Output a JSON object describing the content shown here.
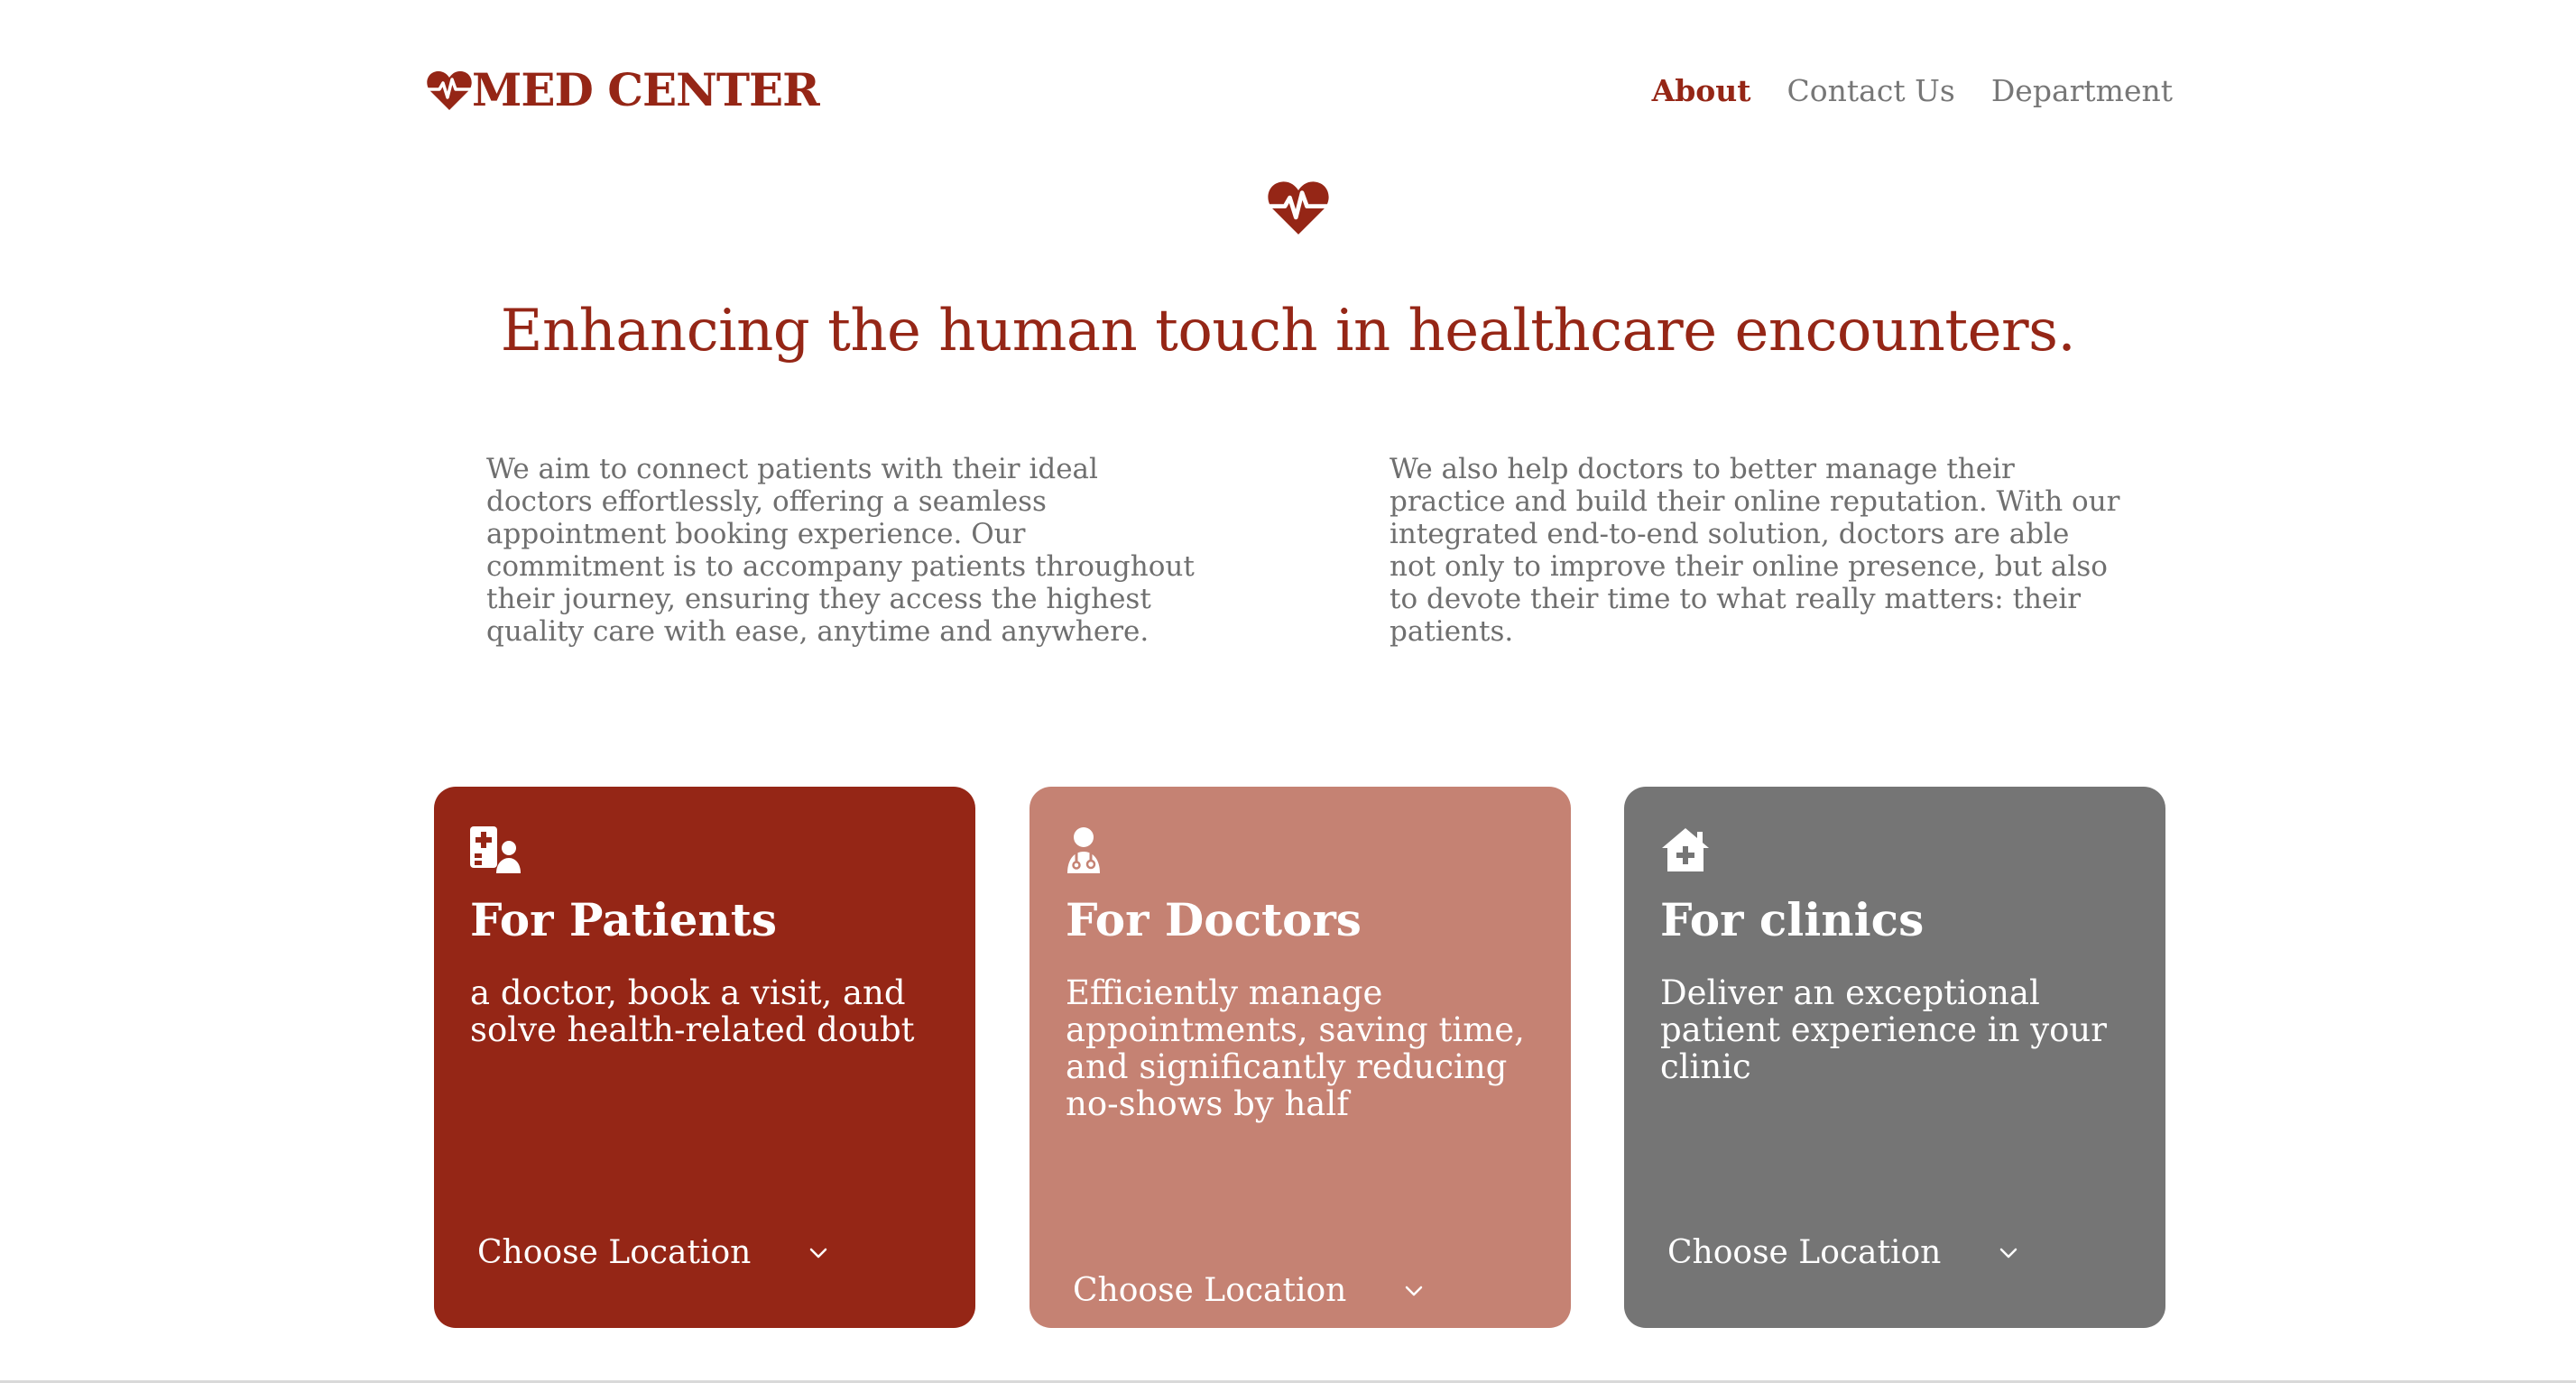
{
  "header": {
    "logo_text": "MED CENTER",
    "logo_icon": "heart-pulse-icon",
    "nav": [
      {
        "label": "About",
        "active": true
      },
      {
        "label": "Contact Us",
        "active": false
      },
      {
        "label": "Department",
        "active": false
      }
    ]
  },
  "hero": {
    "icon": "heart-pulse-icon",
    "title": "Enhancing the human touch in healthcare encounters."
  },
  "intro": {
    "left": "We aim to connect patients with their ideal doctors effortlessly, offering a seamless appointment booking experience. Our commitment is to accompany patients throughout their journey, ensuring they access the highest quality care with ease, anytime and anywhere.",
    "right": "We also help doctors to better manage their practice and build their online reputation. With our integrated end-to-end solution, doctors are able not only to improve their online presence, but also to devote their time to what really matters: their patients."
  },
  "cards": [
    {
      "icon": "hospital-user-icon",
      "title": "For Patients",
      "text": "a doctor, book a visit, and solve health-related doubt",
      "location_label": "Choose Location",
      "color": "#952616"
    },
    {
      "icon": "user-doctor-icon",
      "title": "For Doctors",
      "text": "Efficiently manage appointments, saving time, and significantly reducing no-shows by half",
      "location_label": "Choose Location",
      "color": "#c58273"
    },
    {
      "icon": "house-medical-icon",
      "title": "For clinics",
      "text": "Deliver an exceptional patient experience in your clinic",
      "location_label": "Choose Location",
      "color": "#757575"
    }
  ],
  "colors": {
    "brand": "#952616",
    "muted_text": "#777777",
    "doctor_card": "#c58273",
    "clinic_card": "#757575"
  }
}
